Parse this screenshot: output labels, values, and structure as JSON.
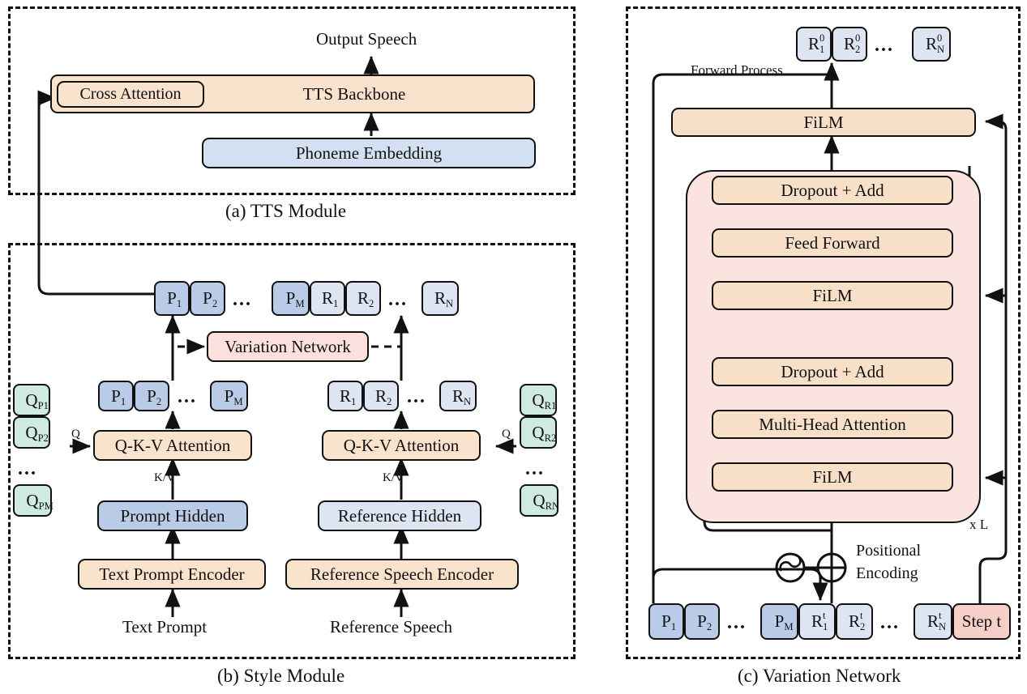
{
  "figure": {
    "captions": {
      "a": "(a)  TTS Module",
      "b": "(b)  Style Module",
      "c": "(c)  Variation Network"
    }
  },
  "tts_module": {
    "output_label": "Output Speech",
    "backbone_label": "TTS Backbone",
    "cross_attention_label": "Cross Attention",
    "phoneme_label": "Phoneme Embedding"
  },
  "style_module": {
    "variation_network_label": "Variation Network",
    "attention_left_label": "Q-K-V Attention",
    "attention_right_label": "Q-K-V Attention",
    "prompt_hidden_label": "Prompt Hidden",
    "reference_hidden_label": "Reference Hidden",
    "text_prompt_encoder_label": "Text Prompt Encoder",
    "reference_speech_encoder_label": "Reference Speech Encoder",
    "text_prompt_input_label": "Text Prompt",
    "reference_speech_input_label": "Reference Speech",
    "q_arrow_left_label": "Q",
    "q_arrow_right_label": "Q",
    "kv_left_label": "K/V",
    "kv_right_label": "K/V",
    "ellipsis": "...",
    "top_sequence": [
      {
        "base": "P",
        "sub": "1",
        "sup": "",
        "style": "dark"
      },
      {
        "base": "P",
        "sub": "2",
        "sup": "",
        "style": "dark"
      },
      {
        "base": "",
        "sub": "",
        "sup": "",
        "style": "gap"
      },
      {
        "base": "P",
        "sub": "M",
        "sup": "",
        "style": "dark"
      },
      {
        "base": "R",
        "sub": "1",
        "sup": "",
        "style": "light"
      },
      {
        "base": "R",
        "sub": "2",
        "sup": "",
        "style": "light"
      },
      {
        "base": "",
        "sub": "",
        "sup": "",
        "style": "gap"
      },
      {
        "base": "R",
        "sub": "N",
        "sup": "",
        "style": "light"
      }
    ],
    "prompt_tokens": [
      {
        "base": "P",
        "sub": "1"
      },
      {
        "base": "P",
        "sub": "2"
      },
      {
        "base": "P",
        "sub": "M"
      }
    ],
    "reference_tokens": [
      {
        "base": "R",
        "sub": "1"
      },
      {
        "base": "R",
        "sub": "2"
      },
      {
        "base": "R",
        "sub": "N"
      }
    ],
    "query_prompt_tokens": [
      {
        "base": "Q",
        "sub": "P1"
      },
      {
        "base": "Q",
        "sub": "P2"
      },
      {
        "base": "Q",
        "sub": "PM"
      }
    ],
    "query_reference_tokens": [
      {
        "base": "Q",
        "sub": "R1"
      },
      {
        "base": "Q",
        "sub": "R2"
      },
      {
        "base": "Q",
        "sub": "RN"
      }
    ]
  },
  "variation_network": {
    "forward_process_label": "Forward Process",
    "positional_encoding_label_line1": "Positional",
    "positional_encoding_label_line2": "Encoding",
    "repeat_label": "x L",
    "ellipsis": "...",
    "blocks": [
      {
        "label": "FiLM",
        "id": "film-top"
      },
      {
        "label": "Dropout + Add",
        "id": "dropout-add-upper"
      },
      {
        "label": "Feed Forward",
        "id": "feed-forward"
      },
      {
        "label": "FiLM",
        "id": "film-mid"
      },
      {
        "label": "Dropout + Add",
        "id": "dropout-add-lower"
      },
      {
        "label": "Multi-Head Attention",
        "id": "multi-head-attention"
      },
      {
        "label": "FiLM",
        "id": "film-bottom"
      }
    ],
    "output_tokens": [
      {
        "base": "R",
        "sub": "1",
        "sup": "0"
      },
      {
        "base": "R",
        "sub": "2",
        "sup": "0"
      },
      {
        "base": "",
        "sub": "",
        "sup": "",
        "style": "gap"
      },
      {
        "base": "R",
        "sub": "N",
        "sup": "0"
      }
    ],
    "input_sequence": [
      {
        "base": "P",
        "sub": "1",
        "sup": "",
        "style": "dark"
      },
      {
        "base": "P",
        "sub": "2",
        "sup": "",
        "style": "dark"
      },
      {
        "base": "",
        "sub": "",
        "sup": "",
        "style": "gap"
      },
      {
        "base": "P",
        "sub": "M",
        "sup": "",
        "style": "dark"
      },
      {
        "base": "R",
        "sub": "1",
        "sup": "t",
        "style": "light"
      },
      {
        "base": "R",
        "sub": "2",
        "sup": "t",
        "style": "light"
      },
      {
        "base": "",
        "sub": "",
        "sup": "",
        "style": "gap"
      },
      {
        "base": "R",
        "sub": "N",
        "sup": "t",
        "style": "light"
      },
      {
        "base": "Step t",
        "sub": "",
        "sup": "",
        "style": "step"
      }
    ],
    "step_label": "Step t"
  },
  "colors": {
    "orange": "#fae3cd",
    "blue": "#d2e0f2",
    "blue_dark": "#b9cbe6",
    "blue_light": "#dde5f2",
    "green": "#cfeade",
    "pink_zone": "#fbe4e0",
    "pink_box": "#f7cfc9",
    "pink_light": "#fbe0dd",
    "stroke": "#111111"
  }
}
